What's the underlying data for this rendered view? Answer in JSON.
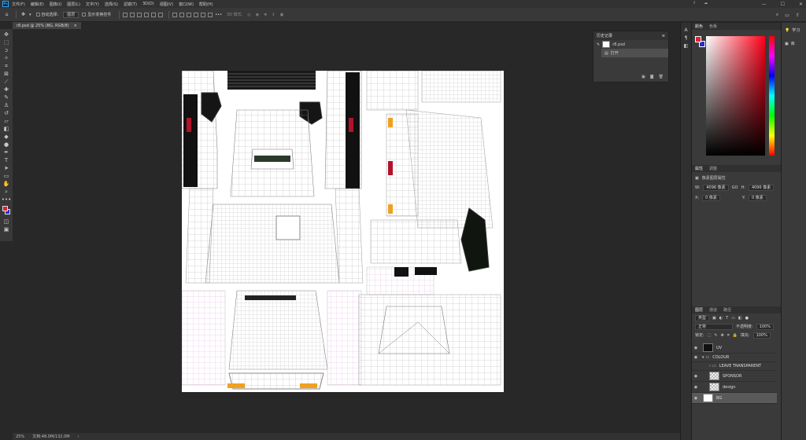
{
  "app": {
    "logo": "Ps",
    "menu": [
      "文件(F)",
      "编辑(E)",
      "图像(I)",
      "图层(L)",
      "文字(Y)",
      "选择(S)",
      "滤镜(T)",
      "3D(D)",
      "视图(V)",
      "窗口(W)",
      "帮助(H)"
    ],
    "window_controls": [
      "—",
      "☐",
      "✕"
    ],
    "accent_color": "#31a8ff"
  },
  "options_bar": {
    "auto_select_label": "自动选择:",
    "auto_select_value": "图层",
    "show_transform_label": "显示变换控件",
    "mode_label": "3D 模式:"
  },
  "document": {
    "tab_title": "r8.psd @ 25% (BG, RGB/8)",
    "tab_close": "×"
  },
  "status": {
    "zoom": "25%",
    "doc_size": "文档:48.0M/132.0M"
  },
  "history": {
    "title": "历史记录",
    "snapshot_name": "r8.psd",
    "step": "打开"
  },
  "color_panel": {
    "tabs": [
      "颜色",
      "色板"
    ],
    "foreground": "#e0202e",
    "background": "#2c2ccc"
  },
  "properties_panel": {
    "tabs": [
      "属性",
      "调整"
    ],
    "header": "像素图层属性",
    "w_label": "W:",
    "w_value": "4096 像素",
    "link": "GO",
    "h_label": "H:",
    "h_value": "4096 像素",
    "x_label": "X:",
    "x_value": "0 像素",
    "y_label": "Y:",
    "y_value": "0 像素"
  },
  "layers_panel": {
    "tabs": [
      "图层",
      "通道",
      "路径"
    ],
    "filter_label": "类型",
    "blend_mode": "正常",
    "opacity_label": "不透明度:",
    "opacity_value": "100%",
    "lock_label": "锁定:",
    "fill_label": "填充:",
    "fill_value": "100%",
    "layers": [
      {
        "name": "UV",
        "kind": "dark"
      },
      {
        "name": "COLOUR",
        "kind": "group"
      },
      {
        "name": "LEAVE TRANSPARENT",
        "kind": "group-child"
      },
      {
        "name": "SPONSOR",
        "kind": "checker"
      },
      {
        "name": "design",
        "kind": "checker"
      },
      {
        "name": "BG",
        "kind": "white"
      }
    ]
  },
  "learn_panel": {
    "learn_label": "学习",
    "library_label": "库"
  }
}
